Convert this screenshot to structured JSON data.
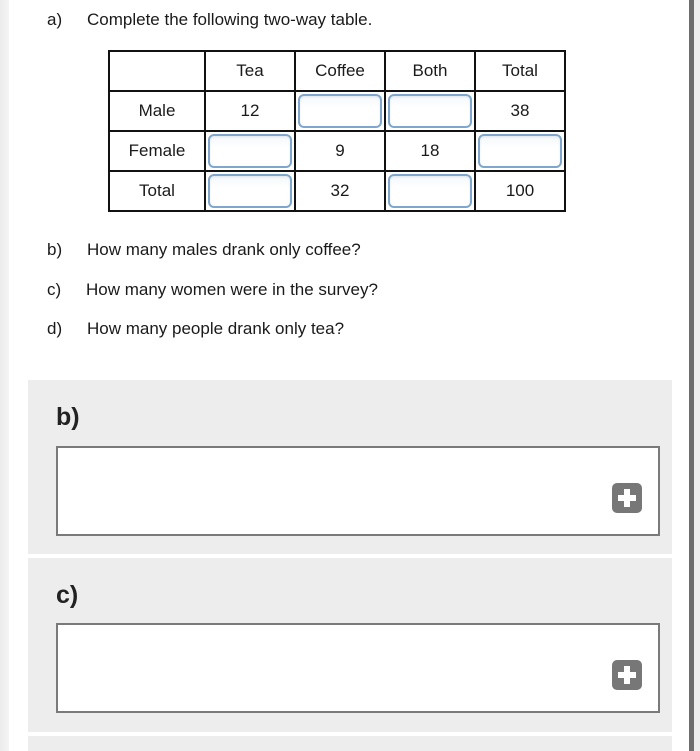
{
  "questions": {
    "a": {
      "letter": "a)",
      "text": "Complete the following two-way table."
    },
    "b": {
      "letter": "b)",
      "text": "How many males drank only coffee?"
    },
    "c": {
      "letter": "c)",
      "text": "How many women were in the survey?"
    },
    "d": {
      "letter": "d)",
      "text": "How many people drank only tea?"
    }
  },
  "table": {
    "headers": [
      "",
      "Tea",
      "Coffee",
      "Both",
      "Total"
    ],
    "rows": [
      {
        "label": "Male",
        "cells": [
          "12",
          null,
          null,
          "38"
        ]
      },
      {
        "label": "Female",
        "cells": [
          null,
          "9",
          "18",
          null
        ]
      },
      {
        "label": "Total",
        "cells": [
          null,
          "32",
          null,
          "100"
        ]
      }
    ],
    "input_value": ""
  },
  "answers": [
    {
      "label": "b)",
      "value": "",
      "add_icon": "plus-square-icon"
    },
    {
      "label": "c)",
      "value": "",
      "add_icon": "plus-square-icon"
    }
  ],
  "colors": {
    "input_border": "#7fa6cc",
    "section_bg": "#ededed",
    "add_button": "#777777"
  }
}
